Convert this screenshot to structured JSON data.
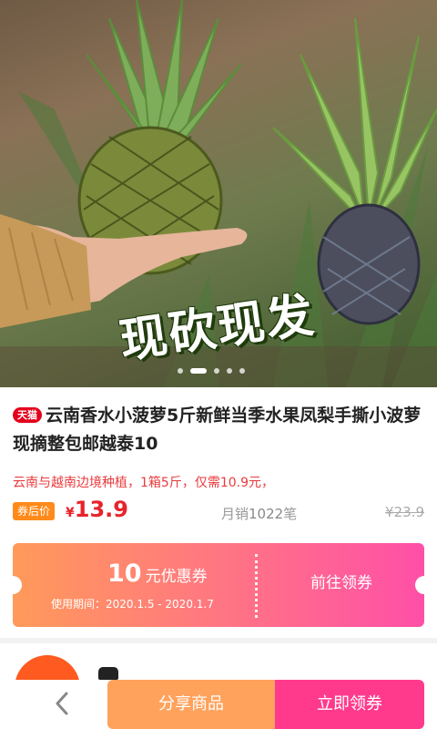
{
  "hero": {
    "banner_text": "现砍现发",
    "image_label": "pineapple-photo",
    "carousel_total": 5,
    "carousel_active": 2
  },
  "product": {
    "platform_badge": "天猫",
    "title": "云南香水小菠萝5斤新鲜当季水果凤梨手撕小波萝现摘整包邮越泰10",
    "description": "云南与越南边境种植，1箱5斤，仅需10.9元，",
    "after_coupon_label": "券后价",
    "currency": "¥",
    "price": "13.9",
    "sales_label": "月销",
    "sales_count": "1022",
    "sales_unit": "笔",
    "original_price": "¥23.9"
  },
  "coupon": {
    "amount": "10",
    "unit": "元优惠券",
    "period_label": "使用期间：",
    "period": "2020.1.5 - 2020.1.7",
    "cta": "前往领券"
  },
  "bottom_bar": {
    "back_icon": "chevron-left-icon",
    "share_label": "分享商品",
    "claim_label": "立即领券"
  },
  "colors": {
    "price_red": "#e8232b",
    "coupon_start": "#ff9a5a",
    "coupon_end": "#ff4fa8",
    "share_orange": "#ffa25c",
    "claim_pink": "#ff3a8c",
    "tmall_red": "#e4001c"
  }
}
